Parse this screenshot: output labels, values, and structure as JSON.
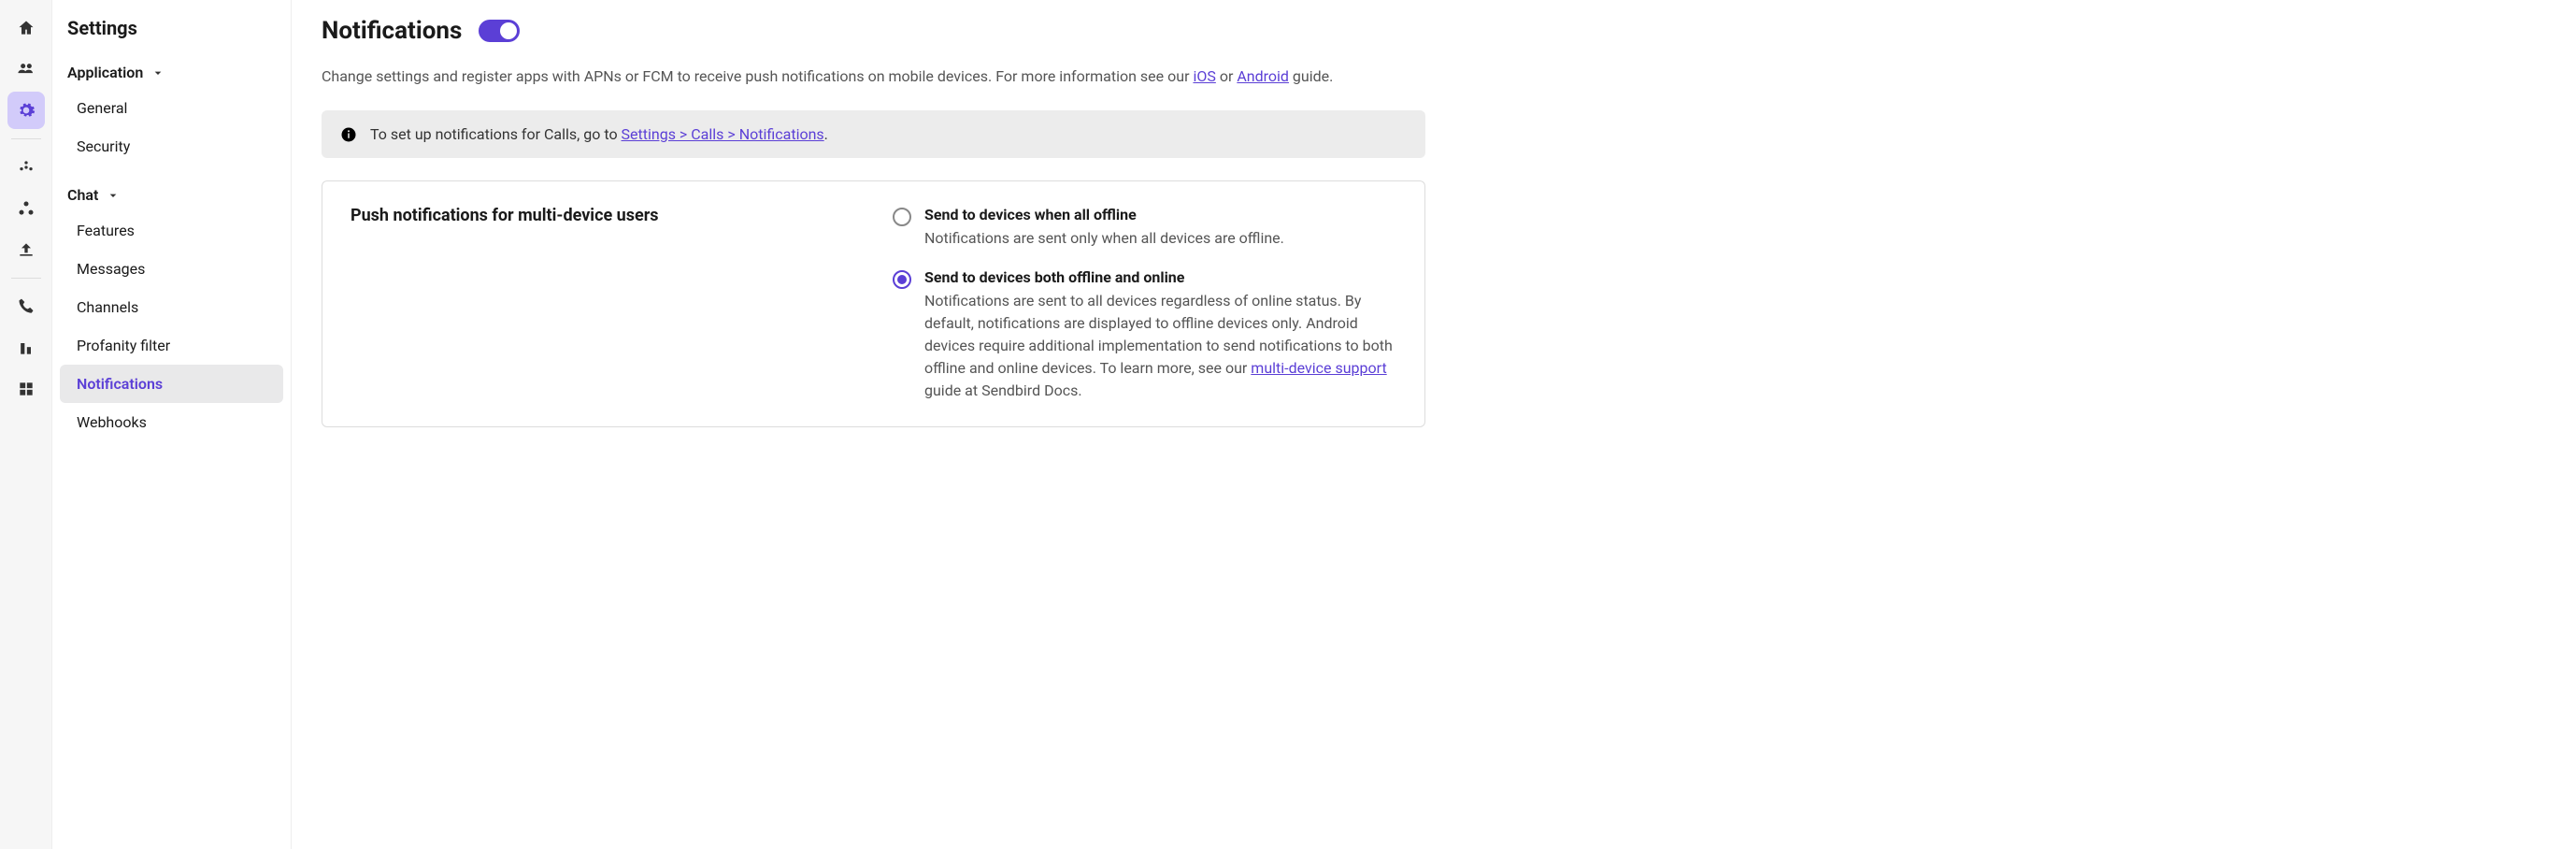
{
  "rail": {
    "items": [
      {
        "name": "home-icon",
        "active": false
      },
      {
        "name": "users-icon",
        "active": false
      },
      {
        "name": "gear-icon",
        "active": true
      },
      {
        "name": "dots-icon",
        "active": false
      },
      {
        "name": "nodes-icon",
        "active": false
      },
      {
        "name": "upload-icon",
        "active": false
      },
      {
        "name": "phone-icon",
        "active": false
      },
      {
        "name": "bars-icon",
        "active": false
      },
      {
        "name": "grid-icon",
        "active": false
      }
    ]
  },
  "sidebar": {
    "title": "Settings",
    "sections": [
      {
        "label": "Application",
        "items": [
          {
            "label": "General",
            "active": false
          },
          {
            "label": "Security",
            "active": false
          }
        ]
      },
      {
        "label": "Chat",
        "items": [
          {
            "label": "Features",
            "active": false
          },
          {
            "label": "Messages",
            "active": false
          },
          {
            "label": "Channels",
            "active": false
          },
          {
            "label": "Profanity filter",
            "active": false
          },
          {
            "label": "Notifications",
            "active": true
          },
          {
            "label": "Webhooks",
            "active": false
          }
        ]
      }
    ]
  },
  "page": {
    "title": "Notifications",
    "toggle_on": true,
    "intro_pre": "Change settings and register apps with APNs or FCM to receive push notifications on mobile devices. For more information see our ",
    "intro_link1": "iOS",
    "intro_mid": " or ",
    "intro_link2": "Android",
    "intro_post": " guide.",
    "banner_pre": "To set up notifications for Calls, go to ",
    "banner_link": "Settings > Calls > Notifications",
    "banner_post": ".",
    "card": {
      "title": "Push notifications for multi-device users",
      "options": [
        {
          "label": "Send to devices when all offline",
          "desc": "Notifications are sent only when all devices are offline.",
          "selected": false
        },
        {
          "label": "Send to devices both offline and online",
          "desc_pre": "Notifications are sent to all devices regardless of online status. By default, notifications are displayed to offline devices only. Android devices require additional implementation to send notifications to both offline and online devices. To learn more, see our ",
          "desc_link": "multi-device support",
          "desc_post": " guide at Sendbird Docs.",
          "selected": true
        }
      ]
    }
  }
}
